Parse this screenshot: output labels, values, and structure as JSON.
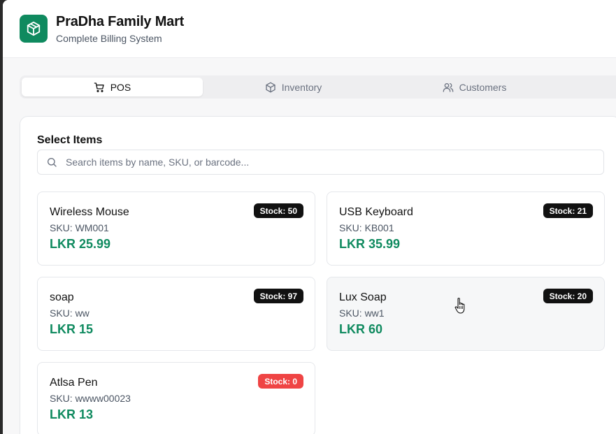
{
  "app": {
    "title": "PraDha Family Mart",
    "subtitle": "Complete Billing System",
    "logo_icon": "package-icon",
    "accent_color": "#0f8a5f"
  },
  "tabs": [
    {
      "label": "POS",
      "icon": "cart-icon",
      "active": true
    },
    {
      "label": "Inventory",
      "icon": "box-icon",
      "active": false
    },
    {
      "label": "Customers",
      "icon": "users-icon",
      "active": false
    }
  ],
  "select_items": {
    "title": "Select Items",
    "search": {
      "placeholder": "Search items by name, SKU, or barcode...",
      "value": ""
    }
  },
  "products": [
    {
      "name": "Wireless Mouse",
      "sku": "SKU: WM001",
      "price": "LKR 25.99",
      "stock": "Stock: 50",
      "in_stock": true
    },
    {
      "name": "USB Keyboard",
      "sku": "SKU: KB001",
      "price": "LKR 35.99",
      "stock": "Stock: 21",
      "in_stock": true
    },
    {
      "name": "soap",
      "sku": "SKU: ww",
      "price": "LKR 15",
      "stock": "Stock: 97",
      "in_stock": true
    },
    {
      "name": "Lux Soap",
      "sku": "SKU: ww1",
      "price": "LKR 60",
      "stock": "Stock: 20",
      "in_stock": true
    },
    {
      "name": "Atlsa Pen",
      "sku": "SKU: wwww00023",
      "price": "LKR 13",
      "stock": "Stock: 0",
      "in_stock": false
    }
  ],
  "colors": {
    "badge_in_stock": "#111111",
    "badge_out_of_stock": "#ef4444",
    "price": "#0f8a5f"
  }
}
